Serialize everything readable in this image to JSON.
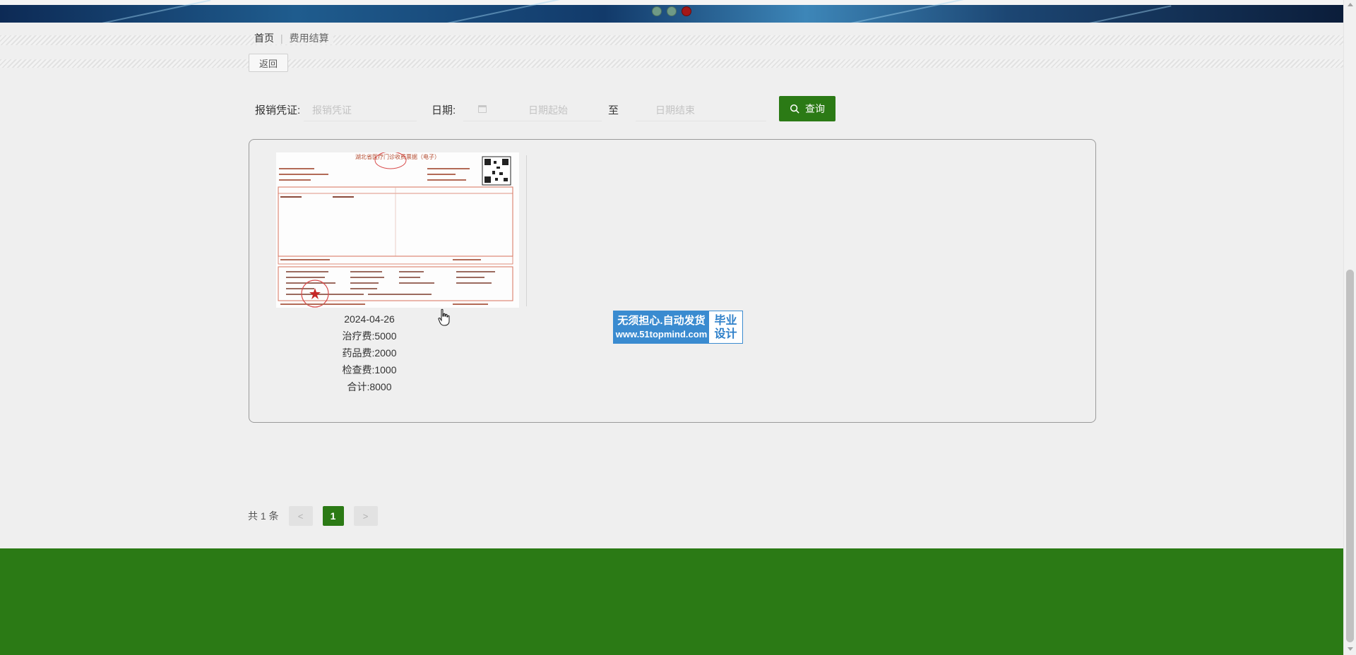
{
  "breadcrumb": {
    "home": "首页",
    "separator": "|",
    "current": "费用结算"
  },
  "back_button": {
    "label": "返回"
  },
  "search": {
    "voucher_label": "报销凭证:",
    "voucher_placeholder": "报销凭证",
    "date_label": "日期:",
    "date_start_placeholder": "日期起始",
    "date_to": "至",
    "date_end_placeholder": "日期结束",
    "query_label": "查询"
  },
  "records": [
    {
      "receipt": {
        "title": "湖北省医疗门诊收费票据（电子）",
        "image_icon": "receipt-image"
      },
      "date": "2024-04-26",
      "treatment_fee": "治疗费:5000",
      "medicine_fee": "药品费:2000",
      "exam_fee": "检查费:1000",
      "total": "合计:8000"
    }
  ],
  "watermark": {
    "line1": "无须担心.自动发货",
    "line2": "www.51topmind.com",
    "side1": "毕业",
    "side2": "设计"
  },
  "pagination": {
    "total_text": "共 1 条",
    "prev": "<",
    "current_page": "1",
    "next": ">"
  },
  "colors": {
    "primary_green": "#2b7a15",
    "watermark_blue": "#3a8bd0",
    "background": "#efefef"
  },
  "banner": {
    "carousel_dots": 3,
    "active_dot": 3
  }
}
